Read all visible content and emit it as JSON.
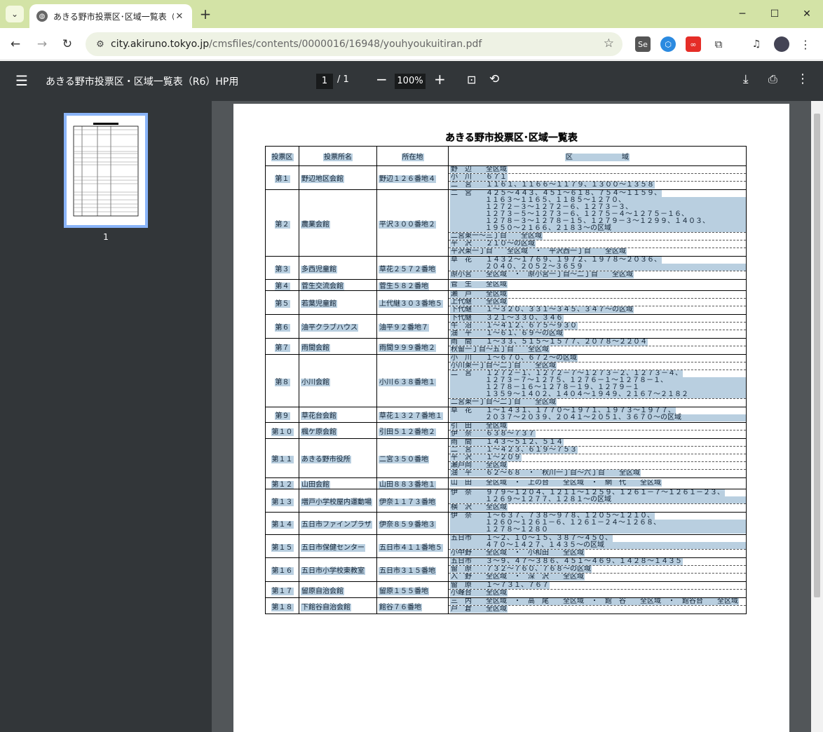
{
  "browser": {
    "tab_title": "あきる野市投票区･区域一覧表（R6）HP用",
    "url_host": "city.akiruno.tokyo.jp",
    "url_path": "/cmsfiles/contents/0000016/16948/youhyoukuitiran.pdf"
  },
  "pdf": {
    "title": "あきる野市投票区・区域一覧表（R6）HP用",
    "page_current": "1",
    "page_sep": "/ 1",
    "zoom": "100%",
    "thumbnail_label": "1"
  },
  "document": {
    "heading": "あきる野市投票区･区域一覧表",
    "headers": [
      "投票区",
      "投票所名",
      "所在地",
      "区　　　　　　　域"
    ],
    "rows": [
      {
        "no": "第１",
        "name": "野辺地区会館",
        "addr": "野辺１２６番地４",
        "lines": [
          [
            "野　辺　　全区域"
          ],
          [
            "小　川　　６７１"
          ],
          [
            "二　宮　　１１６１、１１６６～１１７９、１３００～１３５８"
          ]
        ]
      },
      {
        "no": "第２",
        "name": "農業会館",
        "addr": "平沢３００番地２",
        "lines": [
          [
            "二　宮　　４２５～４４３、４５１～６１８、７５４～１１５９、",
            "１１６３～１１６５、１１８５～１２７０、",
            "１２７２－３～１２７２－６、１２７３－３、",
            "１２７３－５～１２７３－６、１２７５－４～１２７５－１６、",
            "１２７８－３～１２７８－１５、１２７９－３～１２９９、１４０３、",
            "１９５０～２１６６、２１８３～の区域"
          ],
          [
            "二宮東一～三丁目　　全区域"
          ],
          [
            "平　沢　　２１０～の区域"
          ],
          [
            "平沢東一丁目　　全区域　・　平沢西一丁目　　全区域"
          ]
        ]
      },
      {
        "no": "第３",
        "name": "多西児童館",
        "addr": "草花２５７２番地",
        "lines": [
          [
            "草　花　　１４３２～１７６９、１９７２、１９７８～２０３６、",
            "２０４０、２０５２～３６５９"
          ],
          [
            "原小宮　　全区域　・　原小宮一丁目～二丁目　　全区域"
          ]
        ]
      },
      {
        "no": "第４",
        "name": "菅生交流会館",
        "addr": "菅生５８２番地",
        "lines": [
          [
            "菅　生　　全区域"
          ]
        ]
      },
      {
        "no": "第５",
        "name": "若葉児童館",
        "addr": "上代継３０３番地５",
        "lines": [
          [
            "瀬　戸　　全区域"
          ],
          [
            "上代継　　全区域"
          ],
          [
            "下代継　　１～３２０、３３１～３４５、３４７～の区域"
          ]
        ]
      },
      {
        "no": "第６",
        "name": "油平クラブハウス",
        "addr": "油平９２番地７",
        "lines": [
          [
            "下代継　　３２１～３３０、３４６"
          ],
          [
            "牛　沼　　１～４１２、６７５～９３０"
          ],
          [
            "油　平　　１～６１、６９～の区域"
          ]
        ]
      },
      {
        "no": "第７",
        "name": "雨間会館",
        "addr": "雨間９９９番地２",
        "lines": [
          [
            "雨　間　　１～３３、５１５～１５７７、２０７８～２２０４"
          ],
          [
            "秋留一丁目～五丁目　　全区域"
          ]
        ]
      },
      {
        "no": "第８",
        "name": "小川会館",
        "addr": "小川６３８番地１",
        "lines": [
          [
            "小　川　　１～６７０、６７２～の区域"
          ],
          [
            "小川東一丁目～二丁目　　全区域"
          ],
          [
            "二　宮　　１２７２－１、１２７２－７～１２７３－２、１２７３－４、",
            "１２７３－７～１２７５、１２７６－１～１２７８－１、",
            "１２７８－１６～１２７８－１９、１２７９－１",
            "１３５９～１４０２、１４０４～１９４９、２１６７～２１８２"
          ],
          [
            "二宮東一丁目～二丁目　　全区域"
          ]
        ]
      },
      {
        "no": "第９",
        "name": "草花台会館",
        "addr": "草花１３２７番地１",
        "lines": [
          [
            "草　花　　１～１４３１、１７７０～１９７１、１９７３～１９７７、",
            "２０３７～２０３９、２０４１～２０５１、３６７０～の区域"
          ]
        ]
      },
      {
        "no": "第１０",
        "name": "楓ケ原会館",
        "addr": "引田５１２番地２",
        "lines": [
          [
            "引　田　　全区域"
          ],
          [
            "伊　奈　　６３８～７３７"
          ]
        ]
      },
      {
        "no": "第１１",
        "name": "あきる野市役所",
        "addr": "二宮３５０番地",
        "lines": [
          [
            "雨　間　　１４３～５１２、５１４"
          ],
          [
            "二　宮　　１～４２３、６１９～７５３"
          ],
          [
            "平　沢　　１～２０９"
          ],
          [
            "瀬戸岡　　全区域"
          ],
          [
            "油　平　　６２～６８　・　秋川一丁目～六丁目　　全区域"
          ]
        ]
      },
      {
        "no": "第１２",
        "name": "山田会館",
        "addr": "山田８８３番地１",
        "lines": [
          [
            "山　田　　全区域　・　上の台　　全区域　・　網　代　　全区域"
          ]
        ]
      },
      {
        "no": "第１３",
        "name": "増戸小学校屋内運動場",
        "addr": "伊奈１１７３番地",
        "lines": [
          [
            "伊　奈　　９７９～１２０４、１２１１～１２５９、１２６１－７～１２６１－２３、",
            "１２６９～１２７７、１２８１～の区域"
          ],
          [
            "横　沢　　全区域"
          ]
        ]
      },
      {
        "no": "第１４",
        "name": "五日市ファインプラザ",
        "addr": "伊奈８５９番地３",
        "lines": [
          [
            "伊　奈　　１～６３７、７３８～９７８、１２０５～１２１０、",
            "１２６０～１２６１－６、１２６１－２４～１２６８、",
            "１２７８～１２８０"
          ]
        ]
      },
      {
        "no": "第１５",
        "name": "五日市保健センター",
        "addr": "五日市４１１番地５",
        "lines": [
          [
            "五日市　　１～２、１０～１５、３８７～４５０、",
            "４７０～１４２７、１４３５～の区域"
          ],
          [
            "小中野　　全区域　・　小和田　　全区域"
          ]
        ]
      },
      {
        "no": "第１６",
        "name": "五日市小学校東教室",
        "addr": "五日市３１５番地",
        "lines": [
          [
            "五日市　　３～９、４７～３８６、４５１～４６９、１４２８～１４３５"
          ],
          [
            "留　原　　７３２～７６０、７６８～の区域"
          ],
          [
            "入　野　　全区域　・　深　沢　　全区域"
          ]
        ]
      },
      {
        "no": "第１７",
        "name": "留原自治会館",
        "addr": "留原１５５番地",
        "lines": [
          [
            "留　原　　１～７３１、７６７"
          ],
          [
            "小峰台　　全区域"
          ]
        ]
      },
      {
        "no": "第１８",
        "name": "下館谷自治会館",
        "addr": "館谷７６番地",
        "lines": [
          [
            "三　内　　全区域　・　高　尾　　全区域　・　館　谷　　全区域　・　館谷台　　全区域"
          ],
          [
            "戸　倉　　全区域"
          ]
        ]
      }
    ]
  },
  "colors": {
    "highlight": "#b9cfe0",
    "tabbar": "#d3e3a6",
    "pdf_toolbar": "#323639",
    "viewer_bg": "#525659"
  }
}
